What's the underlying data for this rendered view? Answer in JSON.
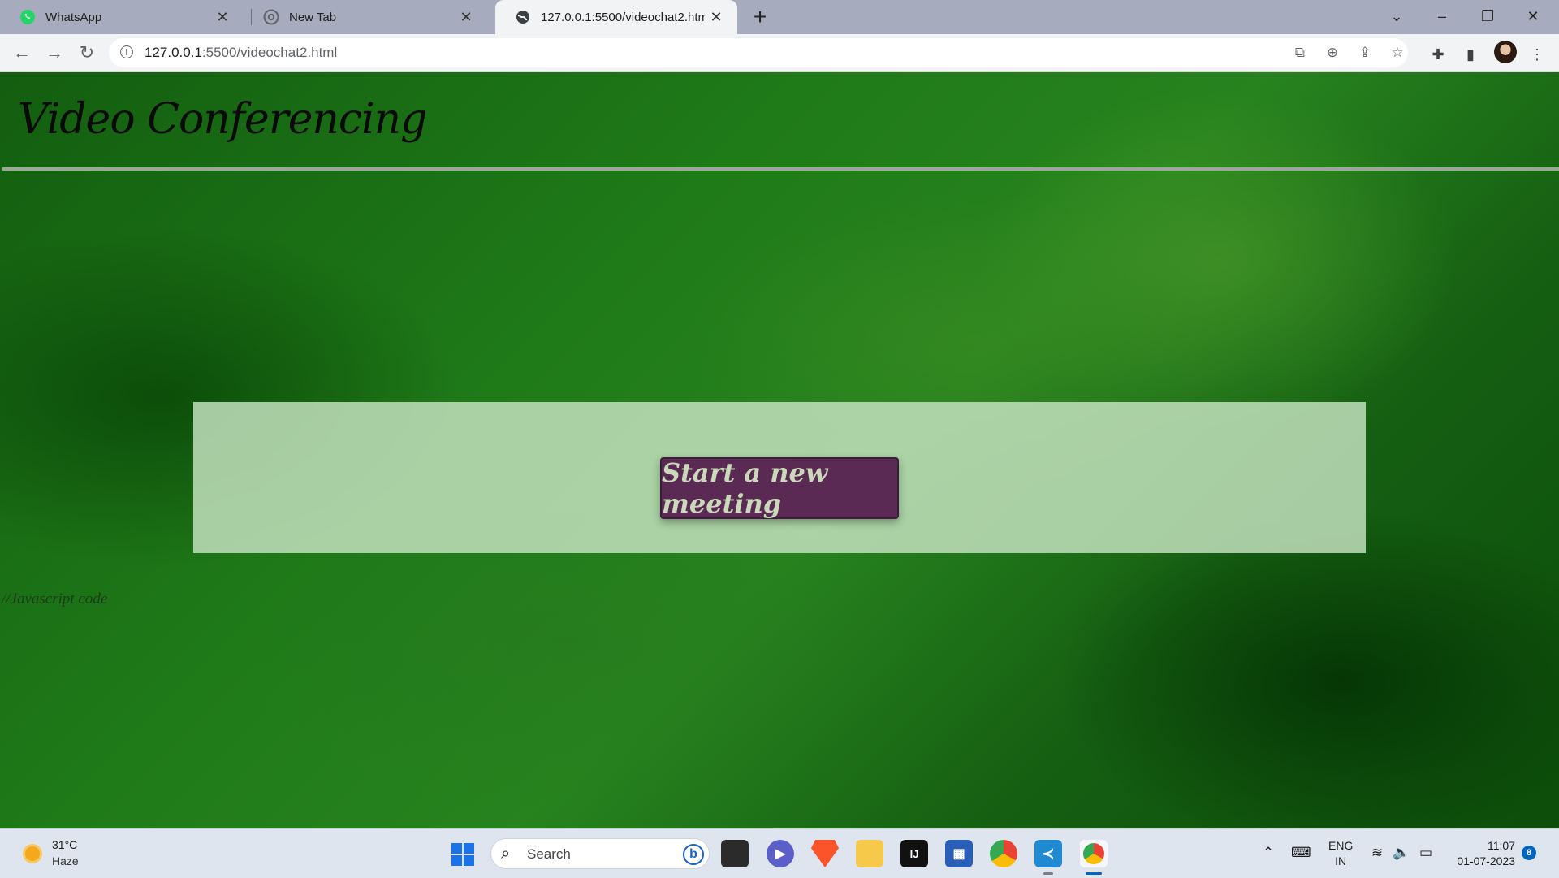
{
  "browser": {
    "tabs": [
      {
        "title": "WhatsApp",
        "icon": "whatsapp-icon"
      },
      {
        "title": "New Tab",
        "icon": "chrome-icon"
      },
      {
        "title": "127.0.0.1:5500/videochat2.html",
        "icon": "globe-icon",
        "active": true
      }
    ],
    "url_host": "127.0.0.1",
    "url_path": ":5500/videochat2.html"
  },
  "page": {
    "title": "Video Conferencing",
    "start_button": "Start a new meeting",
    "comment_text": "//Javascript code"
  },
  "taskbar": {
    "weather_temp": "31°C",
    "weather_desc": "Haze",
    "search_label": "Search",
    "lang_line1": "ENG",
    "lang_line2": "IN",
    "time": "11:07",
    "date": "01-07-2023",
    "notification_count": "8"
  },
  "colors": {
    "page_bg": "#1f7a18",
    "panel_bg": "#c8e4c3",
    "button_bg": "#5a2a55",
    "button_text": "#c9d9b9",
    "accent": "#0067c0"
  }
}
